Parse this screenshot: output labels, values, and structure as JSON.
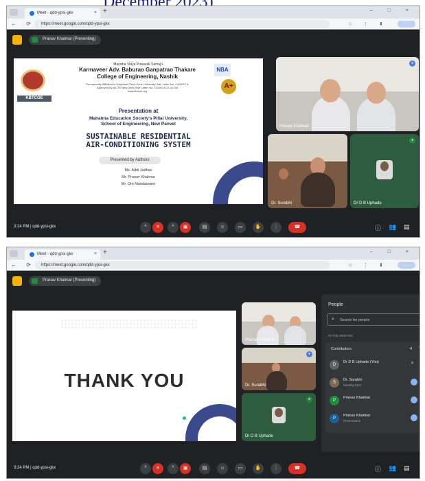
{
  "caption": "December 2023)",
  "browser": {
    "tab_title": "Meet - qdd-ypsi-gkx",
    "url": "https://meet.google.com/qdd-ypsi-gkx"
  },
  "presenting_label": "Pranav Khalmar (Presenting)",
  "slide1": {
    "sanstha": "Maratha Vidya Prasarak Samaj's",
    "college_line1": "Karmaveer Adv. Baburao Ganpatrao Thakare",
    "college_line2": "College of Engineering, Nashik",
    "small_line1": "Permanently Affiliated to Savitribai Phule Pune University Vide Letter No. CA/3242 &",
    "small_line2": "Approved by AICTE New Delhi Vide Letter No. 740-89-92-E-42766",
    "small_line3": "www.kbtcoe.org",
    "logo_tag": "KBTCOE",
    "nba": "NBA",
    "naac": "A+",
    "presentation_at": "Presentation at",
    "mahatma_line1": "Mahatma Education Society's Pillai University,",
    "mahatma_line2": "School of Engineering, New Panvel",
    "title_line1": "SUSTAINABLE RESIDENTIAL",
    "title_line2": "AIR-CONDITIONING SYSTEM",
    "presented_by": "Presented by Authors",
    "authors": [
      "Ms. Aditi Jadhav",
      "Mr. Pranav Khalmar",
      "Mr. Om Mundawane"
    ]
  },
  "tiles1": {
    "t1_label": "Pranav Khalmar",
    "t2_label": "Dr. Surabhi",
    "t3_label": "Dr D B Uphade"
  },
  "controls": {
    "time_code": "3:24 PM  |  qdd-ypsi-gkx"
  },
  "slide2": {
    "thank_you": "THANK YOU"
  },
  "tiles2": {
    "t1_label": "Pranav Khalmar",
    "t2_label": "Dr. Surabhi",
    "t3_label": "Dr D B Uphade"
  },
  "people_panel": {
    "title": "People",
    "search_placeholder": "Search for people",
    "section": "IN THE MEETING",
    "contributors_label": "Contributors",
    "count": "4",
    "people": [
      {
        "initial": "D",
        "name": "Dr D B Uphade (You)",
        "sub": "",
        "color": "#5f6368"
      },
      {
        "initial": "S",
        "name": "Dr. Surabhi",
        "sub": "Meeting host",
        "color": "#7b6a58"
      },
      {
        "initial": "P",
        "name": "Pranav Khalmar",
        "sub": "",
        "color": "#1e8e3e"
      },
      {
        "initial": "P",
        "name": "Pranav Khalmar",
        "sub": "Presentation",
        "color": "#1a5e9a"
      }
    ]
  }
}
